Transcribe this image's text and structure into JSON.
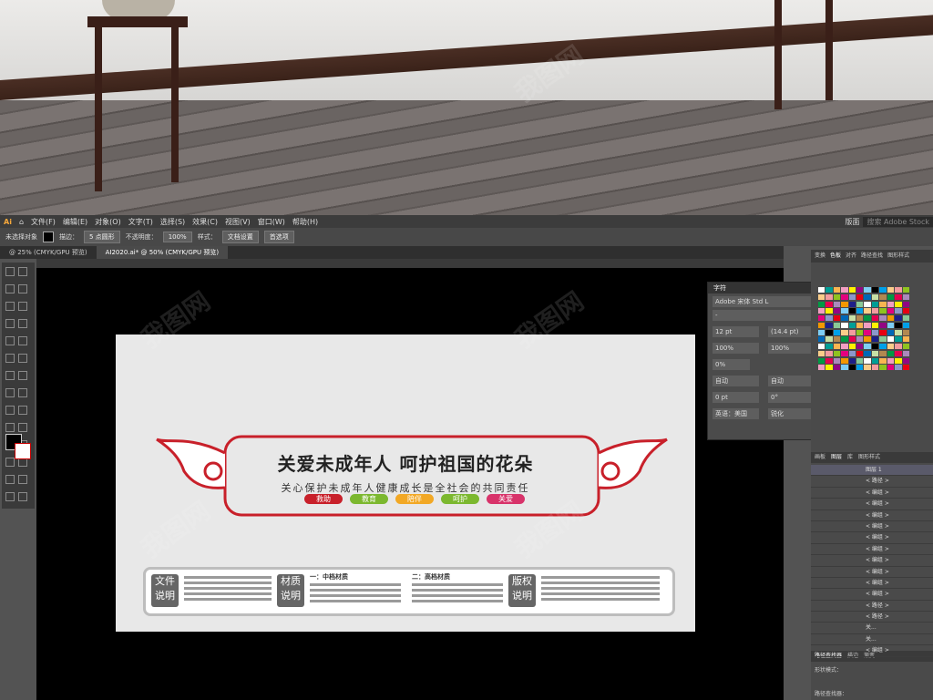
{
  "room": {
    "watermark": "我图网"
  },
  "menubar": {
    "items": [
      "文件(F)",
      "编辑(E)",
      "对象(O)",
      "文字(T)",
      "选择(S)",
      "效果(C)",
      "视图(V)",
      "窗口(W)",
      "帮助(H)"
    ],
    "right_label": "版面",
    "search_placeholder": "搜索 Adobe Stock"
  },
  "ctrlbar": {
    "selection": "未选择对象",
    "stroke_label": "描边：",
    "brush": "5 点圆形",
    "opacity_label": "不透明度：",
    "opacity": "100%",
    "style_label": "样式：",
    "doc_setup": "文档设置",
    "prefs": "首选项"
  },
  "tabs": [
    "@ 25% (CMYK/GPU 预览)",
    "AI2020.ai* @ 50% (CMYK/GPU 预览)"
  ],
  "artboard": {
    "title": "关爱未成年人 呵护祖国的花朵",
    "subtitle": "关心保护未成年人健康成长是全社会的共同责任",
    "tags": [
      {
        "label": "救助",
        "color": "#c8202a"
      },
      {
        "label": "教育",
        "color": "#7cb82f"
      },
      {
        "label": "陪伴",
        "color": "#f2a825"
      },
      {
        "label": "呵护",
        "color": "#7cb82f"
      },
      {
        "label": "关爱",
        "color": "#d8336a"
      }
    ],
    "info": {
      "file_label": "文件说明",
      "material_label": "材质说明",
      "mid_material": "一：中档材质",
      "high_material": "二：高档材质",
      "copyright_label": "版权说明"
    }
  },
  "char_panel": {
    "title": "字符",
    "font": "Adobe 宋体 Std L",
    "style": "-",
    "size": "12 pt",
    "leading": "(14.4 pt)",
    "hscale": "100%",
    "vscale": "100%",
    "tracking": "0%",
    "kern": "自动",
    "kern2": "自动",
    "baseline": "0 pt",
    "rotation": "0°",
    "lang": "英语：美国",
    "aa": "锐化"
  },
  "right_panel": {
    "tabs_top": [
      "变换",
      "色板",
      "对齐",
      "路径查找",
      "图形样式"
    ],
    "layers_tabs": [
      "画板",
      "图层",
      "库",
      "图形样式"
    ],
    "layer_root": "图层 1",
    "layer_items": [
      "< 路径 >",
      "< 编组 >",
      "< 编组 >",
      "< 编组 >",
      "< 编组 >",
      "< 编组 >",
      "< 编组 >",
      "< 编组 >",
      "< 编组 >",
      "< 编组 >",
      "< 编组 >",
      "< 路径 >",
      "< 路径 >",
      "关...",
      "关...",
      "< 编组 >"
    ],
    "bottom_tabs": [
      "路径查找器",
      "描边",
      "渐变"
    ],
    "shape_mode": "形状模式：",
    "pathfinder": "路径查找器："
  },
  "colors": {
    "ui_dark": "#3c3c3c",
    "canvas": "#000000",
    "accent_red": "#c8202a"
  }
}
